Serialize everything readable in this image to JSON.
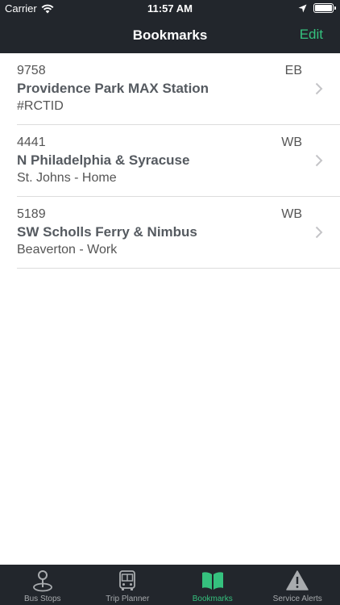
{
  "status_bar": {
    "carrier": "Carrier",
    "time": "11:57 AM"
  },
  "nav": {
    "title": "Bookmarks",
    "edit_label": "Edit"
  },
  "colors": {
    "accent": "#35c17e",
    "bar_background": "#22262c",
    "inactive_tab": "#a8abae"
  },
  "bookmarks": [
    {
      "stop_id": "9758",
      "direction": "EB",
      "name": "Providence Park MAX Station",
      "note": "#RCTID"
    },
    {
      "stop_id": "4441",
      "direction": "WB",
      "name": "N Philadelphia & Syracuse",
      "note": "St. Johns - Home"
    },
    {
      "stop_id": "5189",
      "direction": "WB",
      "name": "SW Scholls Ferry & Nimbus",
      "note": "Beaverton - Work"
    }
  ],
  "tabs": [
    {
      "label": "Bus Stops",
      "icon": "map-pin-icon",
      "active": false
    },
    {
      "label": "Trip Planner",
      "icon": "bus-icon",
      "active": false
    },
    {
      "label": "Bookmarks",
      "icon": "book-icon",
      "active": true
    },
    {
      "label": "Service Alerts",
      "icon": "warning-icon",
      "active": false
    }
  ]
}
